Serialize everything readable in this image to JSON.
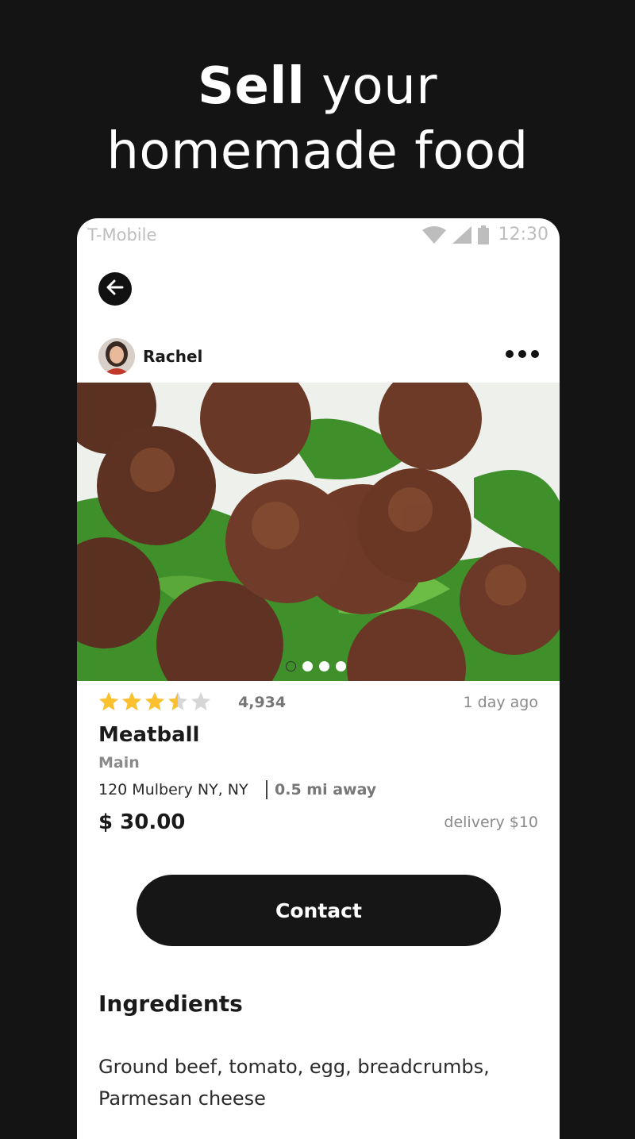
{
  "headline": {
    "bold": "Sell",
    "rest_line1": " your",
    "line2": "homemade food"
  },
  "status_bar": {
    "carrier": "T-Mobile",
    "time": "12:30"
  },
  "seller": {
    "name": "Rachel"
  },
  "photo": {
    "subject": "meatballs on arugula",
    "pages": 4,
    "active_page": 1
  },
  "listing": {
    "rating": 3.5,
    "rating_max": 5,
    "rating_count": "4,934",
    "posted": "1 day ago",
    "name": "Meatball",
    "category": "Main",
    "address": "120 Mulbery NY, NY",
    "distance": "0.5 mi away",
    "price": "$ 30.00",
    "delivery": "delivery $10"
  },
  "actions": {
    "contact_label": "Contact"
  },
  "ingredients": {
    "title": "Ingredients",
    "text": "Ground beef, tomato, egg, breadcrumbs, Parmesan cheese"
  },
  "colors": {
    "background": "#141414",
    "star": "#fbc02d",
    "star_empty": "#d6d6d6",
    "button": "#161616"
  }
}
